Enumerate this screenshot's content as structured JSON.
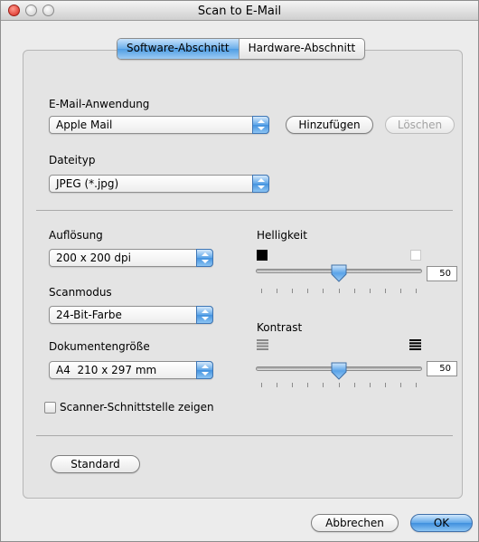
{
  "window": {
    "title": "Scan to E-Mail"
  },
  "tabs": [
    {
      "label": "Software-Abschnitt",
      "active": true
    },
    {
      "label": "Hardware-Abschnitt",
      "active": false
    }
  ],
  "email": {
    "label": "E-Mail-Anwendung",
    "value": "Apple Mail",
    "add_label": "Hinzufügen",
    "delete_label": "Löschen"
  },
  "filetype": {
    "label": "Dateityp",
    "value": "JPEG (*.jpg)"
  },
  "resolution": {
    "label": "Auflösung",
    "value": "200 x 200 dpi"
  },
  "scanmode": {
    "label": "Scanmodus",
    "value": "24-Bit-Farbe"
  },
  "docsize": {
    "label": "Dokumentengröße",
    "value": "A4  210 x 297 mm"
  },
  "scanner_interface": {
    "label": "Scanner-Schnittstelle zeigen",
    "checked": false
  },
  "brightness": {
    "label": "Helligkeit",
    "value": "50",
    "level": 0.5
  },
  "contrast": {
    "label": "Kontrast",
    "value": "50",
    "level": 0.5
  },
  "standard_label": "Standard",
  "footer": {
    "cancel_label": "Abbrechen",
    "ok_label": "OK"
  },
  "colors": {
    "accent": "#4f9de3"
  },
  "icons": [
    "close-icon",
    "minimize-icon",
    "zoom-icon",
    "popup-arrows-icon",
    "black-square-icon",
    "white-square-icon",
    "low-contrast-icon",
    "high-contrast-icon"
  ]
}
